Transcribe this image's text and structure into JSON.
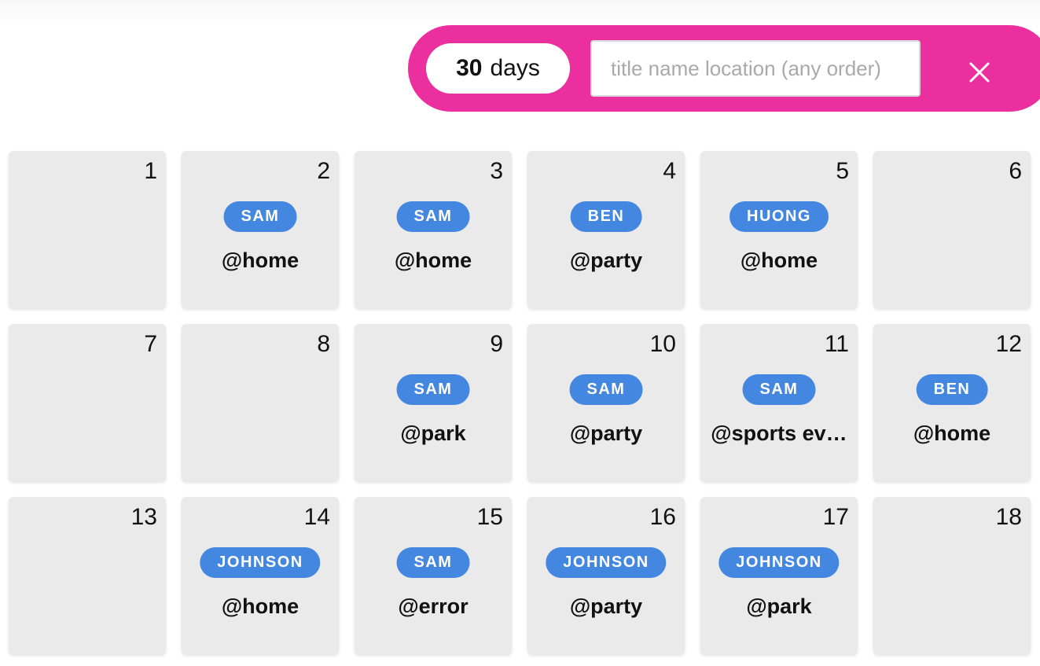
{
  "header": {
    "days_count": "30",
    "days_label": "days",
    "search_placeholder": "title name location (any order)",
    "search_value": "",
    "close_icon": "close-icon",
    "accent_color": "#ec2f9e"
  },
  "calendar": {
    "days": [
      {
        "num": "1"
      },
      {
        "num": "2",
        "name": "SAM",
        "location": "@home"
      },
      {
        "num": "3",
        "name": "SAM",
        "location": "@home"
      },
      {
        "num": "4",
        "name": "BEN",
        "location": "@party"
      },
      {
        "num": "5",
        "name": "HUONG",
        "location": "@home"
      },
      {
        "num": "6"
      },
      {
        "num": "7"
      },
      {
        "num": "8"
      },
      {
        "num": "9",
        "name": "SAM",
        "location": "@park"
      },
      {
        "num": "10",
        "name": "SAM",
        "location": "@party"
      },
      {
        "num": "11",
        "name": "SAM",
        "location": "@sports ev…"
      },
      {
        "num": "12",
        "name": "BEN",
        "location": "@home"
      },
      {
        "num": "13"
      },
      {
        "num": "14",
        "name": "JOHNSON",
        "location": "@home"
      },
      {
        "num": "15",
        "name": "SAM",
        "location": "@error"
      },
      {
        "num": "16",
        "name": "JOHNSON",
        "location": "@party"
      },
      {
        "num": "17",
        "name": "JOHNSON",
        "location": "@park"
      },
      {
        "num": "18"
      }
    ],
    "badge_color": "#4487e0",
    "cell_color": "#eaeaea"
  }
}
